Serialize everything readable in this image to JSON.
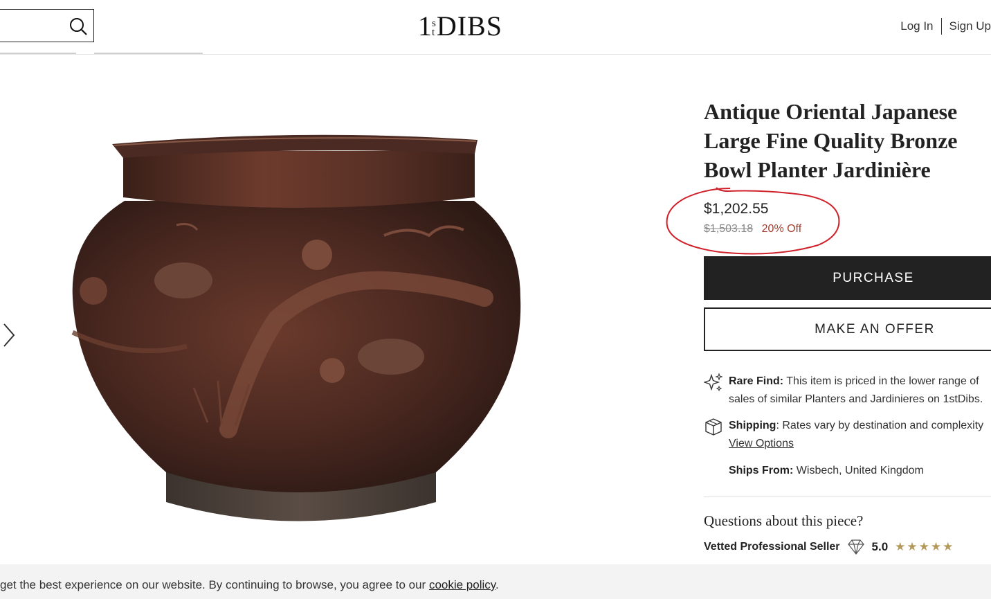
{
  "header": {
    "search_placeholder": "",
    "logo": {
      "one": "1",
      "s": "s",
      "t": "t",
      "dibs": "DIBS"
    },
    "login_label": "Log In",
    "signup_label": "Sign Up"
  },
  "product": {
    "title": "Antique Oriental Japanese Large Fine Quality Bronze Bowl Planter Jardinière",
    "price": "$1,202.55",
    "original_price": "$1,503.18",
    "discount": "20% Off",
    "purchase_label": "PURCHASE",
    "offer_label": "MAKE AN OFFER"
  },
  "info": {
    "rare_label": "Rare Find:",
    "rare_line1": "This item is priced in the lower range of",
    "rare_line2": "sales of similar Planters and Jardinieres on 1stDibs.",
    "shipping_label": "Shipping",
    "shipping_text": ": Rates vary by destination and complexity",
    "view_options": "View Options",
    "ships_from_label": "Ships From:",
    "ships_from_value": "Wisbech, United Kingdom"
  },
  "seller": {
    "questions": "Questions about this piece?",
    "vetted_label": "Vetted Professional Seller",
    "rating": "5.0",
    "stars": "★★★★★"
  },
  "cookie": {
    "text": "get the best experience on our website. By continuing to browse, you agree to our ",
    "link": "cookie policy",
    "end": "."
  },
  "icons": {
    "search": "search-icon",
    "next": "chevron-right-icon",
    "sparkle": "sparkle-icon",
    "box": "box-icon",
    "diamond": "diamond-icon"
  },
  "colors": {
    "annotation": "#d0202a",
    "discount": "#a33c2c",
    "star": "#b39a5a",
    "button_dark": "#222222"
  }
}
